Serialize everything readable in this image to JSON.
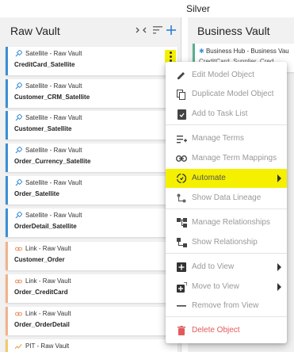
{
  "page": {
    "title": "Silver"
  },
  "raw_vault": {
    "title": "Raw Vault",
    "icons": [
      "collapse-icon",
      "sort-icon",
      "add-icon"
    ],
    "cards": [
      {
        "kind": "Satellite - Raw Vault",
        "name": "CreditCard_Satellite",
        "type": "satellite"
      },
      {
        "kind": "Satellite - Raw Vault",
        "name": "Customer_CRM_Satellite",
        "type": "satellite"
      },
      {
        "kind": "Satellite - Raw Vault",
        "name": "Customer_Satellite",
        "type": "satellite"
      },
      {
        "kind": "Satellite - Raw Vault",
        "name": "Order_Currency_Satellite",
        "type": "satellite"
      },
      {
        "kind": "Satellite - Raw Vault",
        "name": "Order_Satellite",
        "type": "satellite"
      },
      {
        "kind": "Satellite - Raw Vault",
        "name": "OrderDetail_Satellite",
        "type": "satellite"
      },
      {
        "kind": "Link - Raw Vault",
        "name": "Customer_Order",
        "type": "link"
      },
      {
        "kind": "Link - Raw Vault",
        "name": "Order_CreditCard",
        "type": "link"
      },
      {
        "kind": "Link - Raw Vault",
        "name": "Order_OrderDetail",
        "type": "link"
      },
      {
        "kind": "PIT - Raw Vault",
        "name": "",
        "type": "pit"
      }
    ]
  },
  "business_vault": {
    "title": "Business Vault",
    "cards": [
      {
        "kind": "Business Hub - Business Vau",
        "name": "CreditCard_Supplier_Cred..."
      }
    ]
  },
  "colors": {
    "satellite": "#3a8fd6",
    "link": "#f2b38a",
    "pit": "#f5c86a",
    "highlight": "#f4f000",
    "danger": "#e05a5a"
  },
  "context_menu": {
    "items": [
      {
        "label": "Edit Model Object",
        "icon": "pencil-icon"
      },
      {
        "label": "Duplicate Model Object",
        "icon": "copy-icon"
      },
      {
        "label": "Add to Task List",
        "icon": "task-icon"
      },
      {
        "label": "Manage Terms",
        "icon": "playlist-add-icon"
      },
      {
        "label": "Manage Term Mappings",
        "icon": "link-icon"
      },
      {
        "label": "Automate",
        "icon": "automate-icon",
        "submenu": true,
        "highlighted": true
      },
      {
        "label": "Show Data Lineage",
        "icon": "lineage-icon"
      },
      {
        "label": "Manage Relationships",
        "icon": "relationships-icon"
      },
      {
        "label": "Show Relationship",
        "icon": "relationship-icon"
      },
      {
        "label": "Add to View",
        "icon": "add-box-icon",
        "submenu": true
      },
      {
        "label": "Move to View",
        "icon": "move-icon",
        "submenu": true
      },
      {
        "label": "Remove from View",
        "icon": "minus-icon"
      },
      {
        "label": "Delete Object",
        "icon": "trash-icon",
        "danger": true
      }
    ]
  }
}
